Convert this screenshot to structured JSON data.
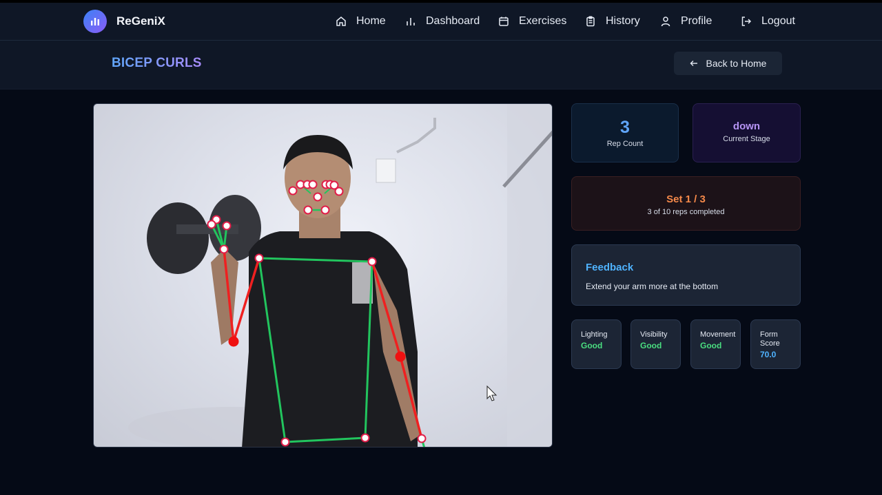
{
  "app": {
    "name": "ReGeniX"
  },
  "nav": {
    "home": "Home",
    "dashboard": "Dashboard",
    "exercises": "Exercises",
    "history": "History",
    "profile": "Profile",
    "logout": "Logout"
  },
  "header": {
    "title": "BICEP CURLS",
    "back_label": "Back to Home"
  },
  "stats": {
    "rep_count": "3",
    "rep_label": "Rep Count",
    "stage_value": "down",
    "stage_label": "Current Stage"
  },
  "set": {
    "title": "Set 1 / 3",
    "subtitle": "3 of 10 reps completed"
  },
  "feedback": {
    "title": "Feedback",
    "message": "Extend your arm more at the bottom"
  },
  "metrics": [
    {
      "label": "Lighting",
      "value": "Good"
    },
    {
      "label": "Visibility",
      "value": "Good"
    },
    {
      "label": "Movement",
      "value": "Good"
    },
    {
      "label": "Form Score",
      "value": "70.0"
    }
  ],
  "colors": {
    "accent_blue": "#60a5fa",
    "accent_purple": "#a78bfa",
    "good_green": "#4ade80",
    "warning_orange": "#f5894a",
    "skeleton_good": "#22c55e",
    "skeleton_bad": "#ef2020"
  },
  "icons": [
    "chart-bars-icon",
    "home-icon",
    "bar-chart-icon",
    "calendar-icon",
    "clipboard-icon",
    "user-icon",
    "logout-icon",
    "arrow-left-icon",
    "mouse-cursor-icon"
  ]
}
